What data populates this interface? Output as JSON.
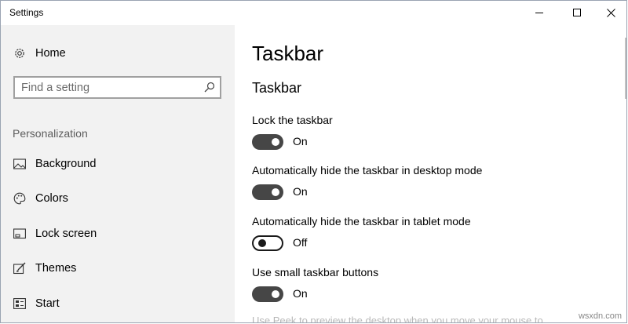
{
  "window": {
    "title": "Settings",
    "controls": [
      "minimize-icon",
      "maximize-icon",
      "close-icon"
    ]
  },
  "sidebar": {
    "home": {
      "label": "Home",
      "icon": "gear-icon"
    },
    "search": {
      "placeholder": "Find a setting",
      "value": "",
      "icon": "search-icon"
    },
    "section": "Personalization",
    "items": [
      {
        "label": "Background",
        "icon": "picture-icon"
      },
      {
        "label": "Colors",
        "icon": "palette-icon"
      },
      {
        "label": "Lock screen",
        "icon": "lock-screen-icon"
      },
      {
        "label": "Themes",
        "icon": "brush-icon"
      },
      {
        "label": "Start",
        "icon": "start-icon"
      }
    ]
  },
  "main": {
    "page_title": "Taskbar",
    "group_title": "Taskbar",
    "settings": [
      {
        "label": "Lock the taskbar",
        "on": true,
        "state": "On"
      },
      {
        "label": "Automatically hide the taskbar in desktop mode",
        "on": true,
        "state": "On"
      },
      {
        "label": "Automatically hide the taskbar in tablet mode",
        "on": false,
        "state": "Off"
      },
      {
        "label": "Use small taskbar buttons",
        "on": true,
        "state": "On"
      }
    ],
    "partial_text": "Use Peek to preview the desktop when you move your mouse to"
  },
  "watermark": "wsxdn.com",
  "colors": {
    "sidebar_bg": "#f2f2f2",
    "toggle_on": "#464646",
    "toggle_off_border": "#1a1a1a"
  }
}
